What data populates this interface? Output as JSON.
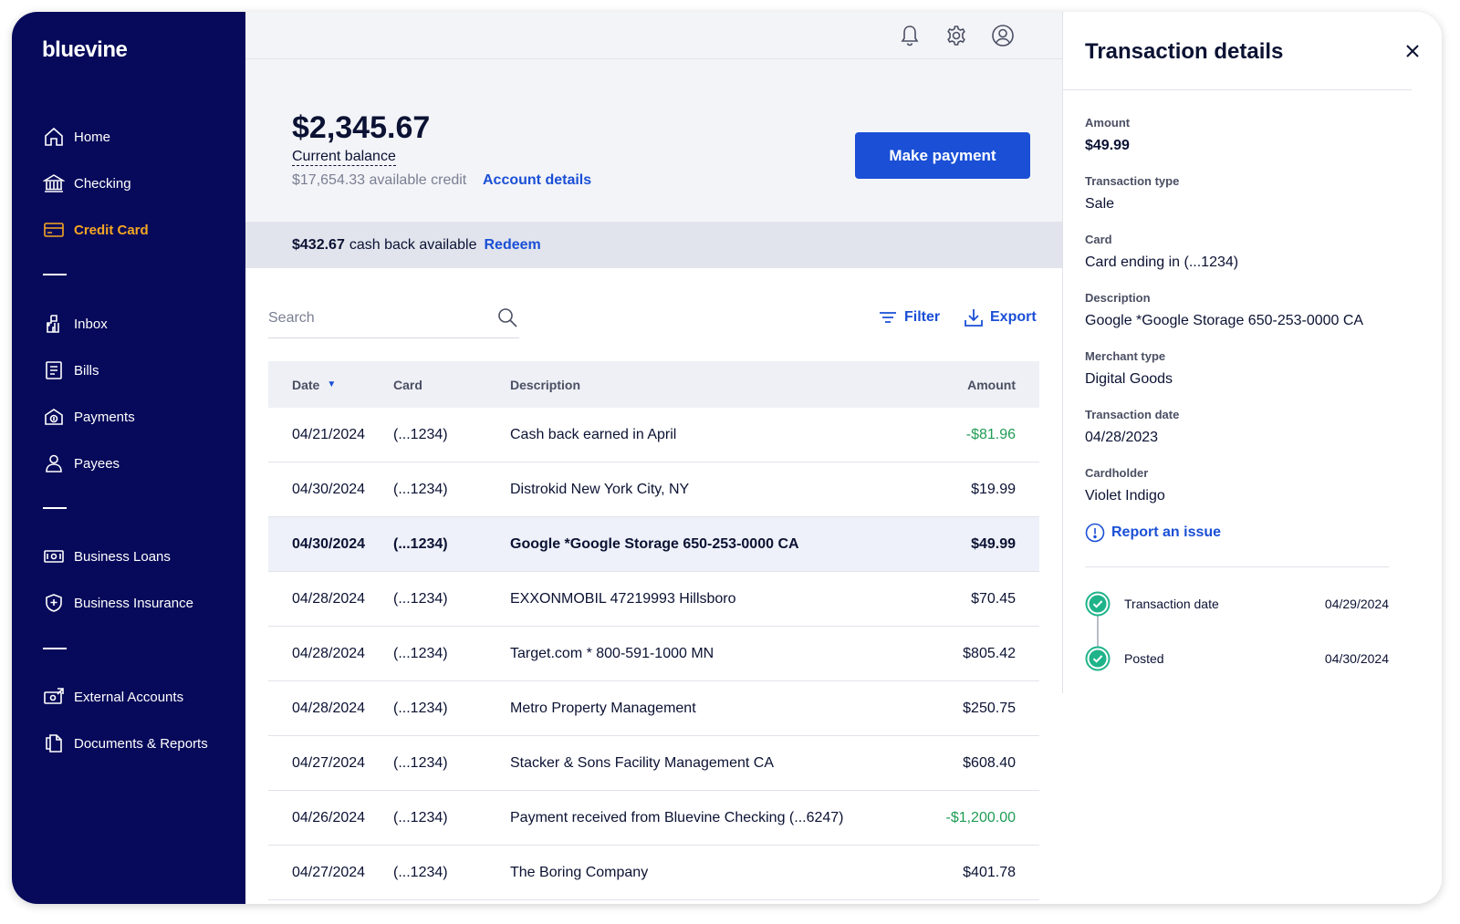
{
  "brand": "bluevine",
  "sidebar": {
    "items": [
      {
        "label": "Home",
        "icon": "home-icon"
      },
      {
        "label": "Checking",
        "icon": "bank-icon"
      },
      {
        "label": "Credit Card",
        "icon": "credit-card-icon",
        "active": true
      },
      {
        "label": "Inbox",
        "icon": "inbox-icon"
      },
      {
        "label": "Bills",
        "icon": "bill-icon"
      },
      {
        "label": "Payments",
        "icon": "payments-icon"
      },
      {
        "label": "Payees",
        "icon": "person-icon"
      },
      {
        "label": "Business Loans",
        "icon": "cash-icon"
      },
      {
        "label": "Business Insurance",
        "icon": "shield-icon"
      },
      {
        "label": "External Accounts",
        "icon": "external-accounts-icon"
      },
      {
        "label": "Documents & Reports",
        "icon": "documents-icon"
      }
    ]
  },
  "topbar": {
    "icons": [
      "bell-icon",
      "gear-icon",
      "user-icon"
    ]
  },
  "summary": {
    "balance": "$2,345.67",
    "balance_label": "Current balance",
    "available_credit": "$17,654.33 available credit",
    "account_details_link": "Account details",
    "make_payment": "Make payment"
  },
  "cashback": {
    "amount": "$432.67",
    "text": "cash back available",
    "redeem": "Redeem"
  },
  "toolbar": {
    "search_placeholder": "Search",
    "filter_label": "Filter",
    "export_label": "Export"
  },
  "table": {
    "columns": [
      "Date",
      "Card",
      "Description",
      "Amount"
    ],
    "rows": [
      {
        "date": "04/21/2024",
        "card": "(...1234)",
        "description": "Cash back earned in April",
        "amount": "-$81.96"
      },
      {
        "date": "04/30/2024",
        "card": "(...1234)",
        "description": "Distrokid New York City, NY",
        "amount": "$19.99"
      },
      {
        "date": "04/30/2024",
        "card": "(...1234)",
        "description": "Google *Google Storage 650-253-0000 CA",
        "amount": "$49.99"
      },
      {
        "date": "04/28/2024",
        "card": "(...1234)",
        "description": "EXXONMOBIL 47219993 Hillsboro",
        "amount": "$70.45"
      },
      {
        "date": "04/28/2024",
        "card": "(...1234)",
        "description": "Target.com * 800-591-1000 MN",
        "amount": "$805.42"
      },
      {
        "date": "04/28/2024",
        "card": "(...1234)",
        "description": "Metro Property Management",
        "amount": "$250.75"
      },
      {
        "date": "04/27/2024",
        "card": "(...1234)",
        "description": "Stacker & Sons Facility Management CA",
        "amount": "$608.40"
      },
      {
        "date": "04/26/2024",
        "card": "(...1234)",
        "description": "Payment received from Bluevine Checking (...6247)",
        "amount": "-$1,200.00"
      },
      {
        "date": "04/27/2024",
        "card": "(...1234)",
        "description": "The Boring Company",
        "amount": "$401.78"
      }
    ]
  },
  "details": {
    "title": "Transaction details",
    "fields": [
      {
        "label": "Amount",
        "value": "$49.99"
      },
      {
        "label": "Transaction type",
        "value": "Sale"
      },
      {
        "label": "Card",
        "value": "Card ending in (...1234)"
      },
      {
        "label": "Description",
        "value": "Google *Google Storage 650-253-0000 CA"
      },
      {
        "label": "Merchant type",
        "value": "Digital Goods"
      },
      {
        "label": "Transaction date",
        "value": "04/28/2023"
      },
      {
        "label": "Cardholder",
        "value": "Violet Indigo"
      }
    ],
    "report_issue": "Report an issue",
    "timeline": [
      {
        "label": "Transaction date",
        "date": "04/29/2024"
      },
      {
        "label": "Posted",
        "date": "04/30/2024"
      }
    ]
  },
  "colors": {
    "sidebar": "#070a5a",
    "accent": "#1a4fd6",
    "active_nav": "#f5a623",
    "credit_green": "#1f9d55",
    "timeline_green": "#1fb38a"
  }
}
